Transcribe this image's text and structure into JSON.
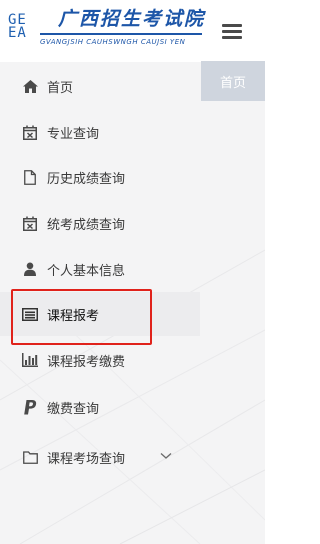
{
  "header": {
    "logo_mark_line1": "GE",
    "logo_mark_line2": "EA",
    "logo_title": "广西招生考试院",
    "logo_subtitle": "GVANGJSIH CAUHSWNGH CAUJSI YEN",
    "menu_icon": "hamburger-icon"
  },
  "tab": {
    "label": "首页"
  },
  "sidebar": {
    "items": [
      {
        "label": "首页",
        "icon": "home-icon"
      },
      {
        "label": "专业查询",
        "icon": "calendar-x-icon"
      },
      {
        "label": "历史成绩查询",
        "icon": "file-icon"
      },
      {
        "label": "统考成绩查询",
        "icon": "calendar-x-icon"
      },
      {
        "label": "个人基本信息",
        "icon": "user-icon"
      },
      {
        "label": "课程报考",
        "icon": "list-card-icon"
      },
      {
        "label": "课程报考缴费",
        "icon": "bar-chart-icon"
      },
      {
        "label": "缴费查询",
        "icon": "paypal-icon"
      },
      {
        "label": "课程考场查询",
        "icon": "folder-icon"
      }
    ]
  },
  "colors": {
    "highlight": "#e0221b",
    "brand": "#1d56a8",
    "tab_bg": "#cfd5de"
  }
}
